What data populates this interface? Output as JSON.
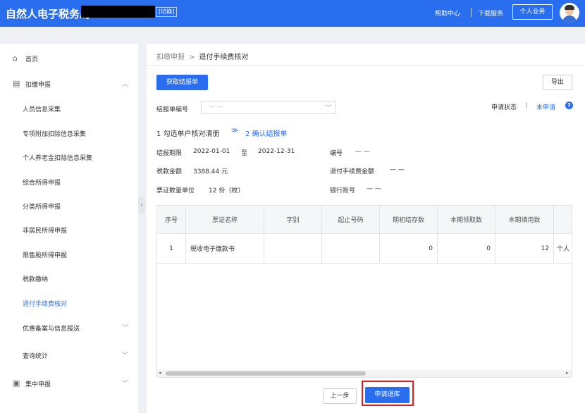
{
  "header": {
    "title": "自然人电子税务局",
    "switch_label": "[切换]",
    "help_label": "帮助中心",
    "download_label": "下载服务",
    "personal_label": "个人业务"
  },
  "sidebar": {
    "items": [
      {
        "label": "首页",
        "icon": "home-icon"
      },
      {
        "label": "扣缴申报",
        "icon": "form-icon"
      },
      {
        "label": "人员信息采集"
      },
      {
        "label": "专项附加扣除信息采集"
      },
      {
        "label": "个人养老金扣除信息采集"
      },
      {
        "label": "综合所得申报"
      },
      {
        "label": "分类所得申报"
      },
      {
        "label": "非居民所得申报"
      },
      {
        "label": "限售股所得申报"
      },
      {
        "label": "税款缴纳"
      },
      {
        "label": "退付手续费核对"
      },
      {
        "label": "优惠备案与信息报送"
      },
      {
        "label": "查询统计"
      },
      {
        "label": "集中申报",
        "icon": "batch-icon"
      }
    ],
    "active_color": "#2a6ef0"
  },
  "breadcrumb": {
    "parent": "扣缴申报",
    "separator": ">",
    "current": "退付手续费核对"
  },
  "toolbar": {
    "fetch_label": "获取结报单",
    "export_label": "导出"
  },
  "form": {
    "report_no_label": "结报单编号",
    "report_no_placeholder": "— —",
    "apply_status_label": "申请状态",
    "status_sep": "|",
    "apply_status_value": "未申请"
  },
  "steps": {
    "step1": "1 勾选单户核对清册",
    "arrow": "≫",
    "step2": "2 确认结报单"
  },
  "info": {
    "period_label": "结报期限",
    "period_start": "2022-01-01",
    "period_to": "至",
    "period_end": "2022-12-31",
    "number_label": "编号",
    "number_value": "— —",
    "tax_amount_label": "税款金额",
    "tax_amount_value": "3388.44 元",
    "refund_fee_label": "退付手续费金额",
    "refund_fee_value": "— —",
    "voucher_label": "票证数量单位",
    "voucher_value": "12 份（枚）",
    "bank_label": "银行账号",
    "bank_value": "— —"
  },
  "table": {
    "columns": [
      "序号",
      "票证名称",
      "字别",
      "起止号码",
      "期初结存数",
      "本期领取数",
      "本期填用数"
    ],
    "rows": [
      [
        "1",
        "税收电子缴款书",
        "",
        "",
        "0",
        "0",
        "12",
        "个人"
      ]
    ]
  },
  "footer": {
    "prev_label": "上一步",
    "submit_label": "申请退库"
  },
  "colors": {
    "primary": "#2a6ef0",
    "highlight": "#e21d1d"
  }
}
